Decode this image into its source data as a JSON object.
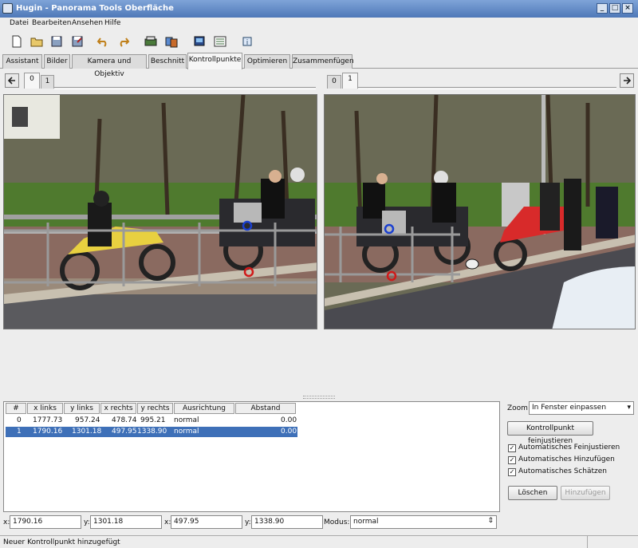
{
  "window": {
    "title": "Hugin - Panorama Tools Oberfläche"
  },
  "menu": [
    "Datei",
    "Bearbeiten",
    "Ansehen",
    "Hilfe"
  ],
  "toolbar": {
    "icons": [
      "new-file-icon",
      "open-folder-icon",
      "save-icon",
      "save-as-icon",
      "undo-icon",
      "redo-icon",
      "preview-icon",
      "stitch-icon",
      "fast-preview-icon",
      "layout-icon",
      "info-icon"
    ]
  },
  "tabs": [
    "Assistant",
    "Bilder",
    "Kamera und Objektiv",
    "Beschnitt",
    "Kontrollpunkte",
    "Optimieren",
    "Zusammenfügen"
  ],
  "left_image_tabs": [
    "0",
    "1"
  ],
  "right_image_tabs": [
    "0",
    "1"
  ],
  "table": {
    "headers": [
      "#",
      "x links",
      "y links",
      "x rechts",
      "y rechts",
      "Ausrichtung",
      "Abstand"
    ],
    "rows": [
      [
        "0",
        "1777.73",
        "957.24",
        "478.74",
        "995.21",
        "normal",
        "0.00"
      ],
      [
        "1",
        "1790.16",
        "1301.18",
        "497.95",
        "1338.90",
        "normal",
        "0.00"
      ]
    ]
  },
  "side": {
    "zoom_label": "Zoom:",
    "zoom_value": "In Fenster einpassen",
    "fine_tune": "Kontrollpunkt feinjustieren",
    "checks": [
      "Automatisches Feinjustieren",
      "Automatisches Hinzufügen",
      "Automatisches Schätzen"
    ],
    "delete": "Löschen",
    "add": "Hinzufügen"
  },
  "bottom": {
    "x1_label": "x:",
    "x1": "1790.16",
    "y1_label": "y:",
    "y1": "1301.18",
    "x2_label": "x:",
    "x2": "497.95",
    "y2_label": "y:",
    "y2": "1338.90",
    "mode_label": "Modus:",
    "mode": "normal"
  },
  "status": "Neuer Kontrollpunkt hinzugefügt",
  "colors": {
    "selection": "#3e70b8",
    "titlebar": "#4e78b8",
    "cp_blue": "#1a3fd0",
    "cp_red": "#d01a1a"
  }
}
